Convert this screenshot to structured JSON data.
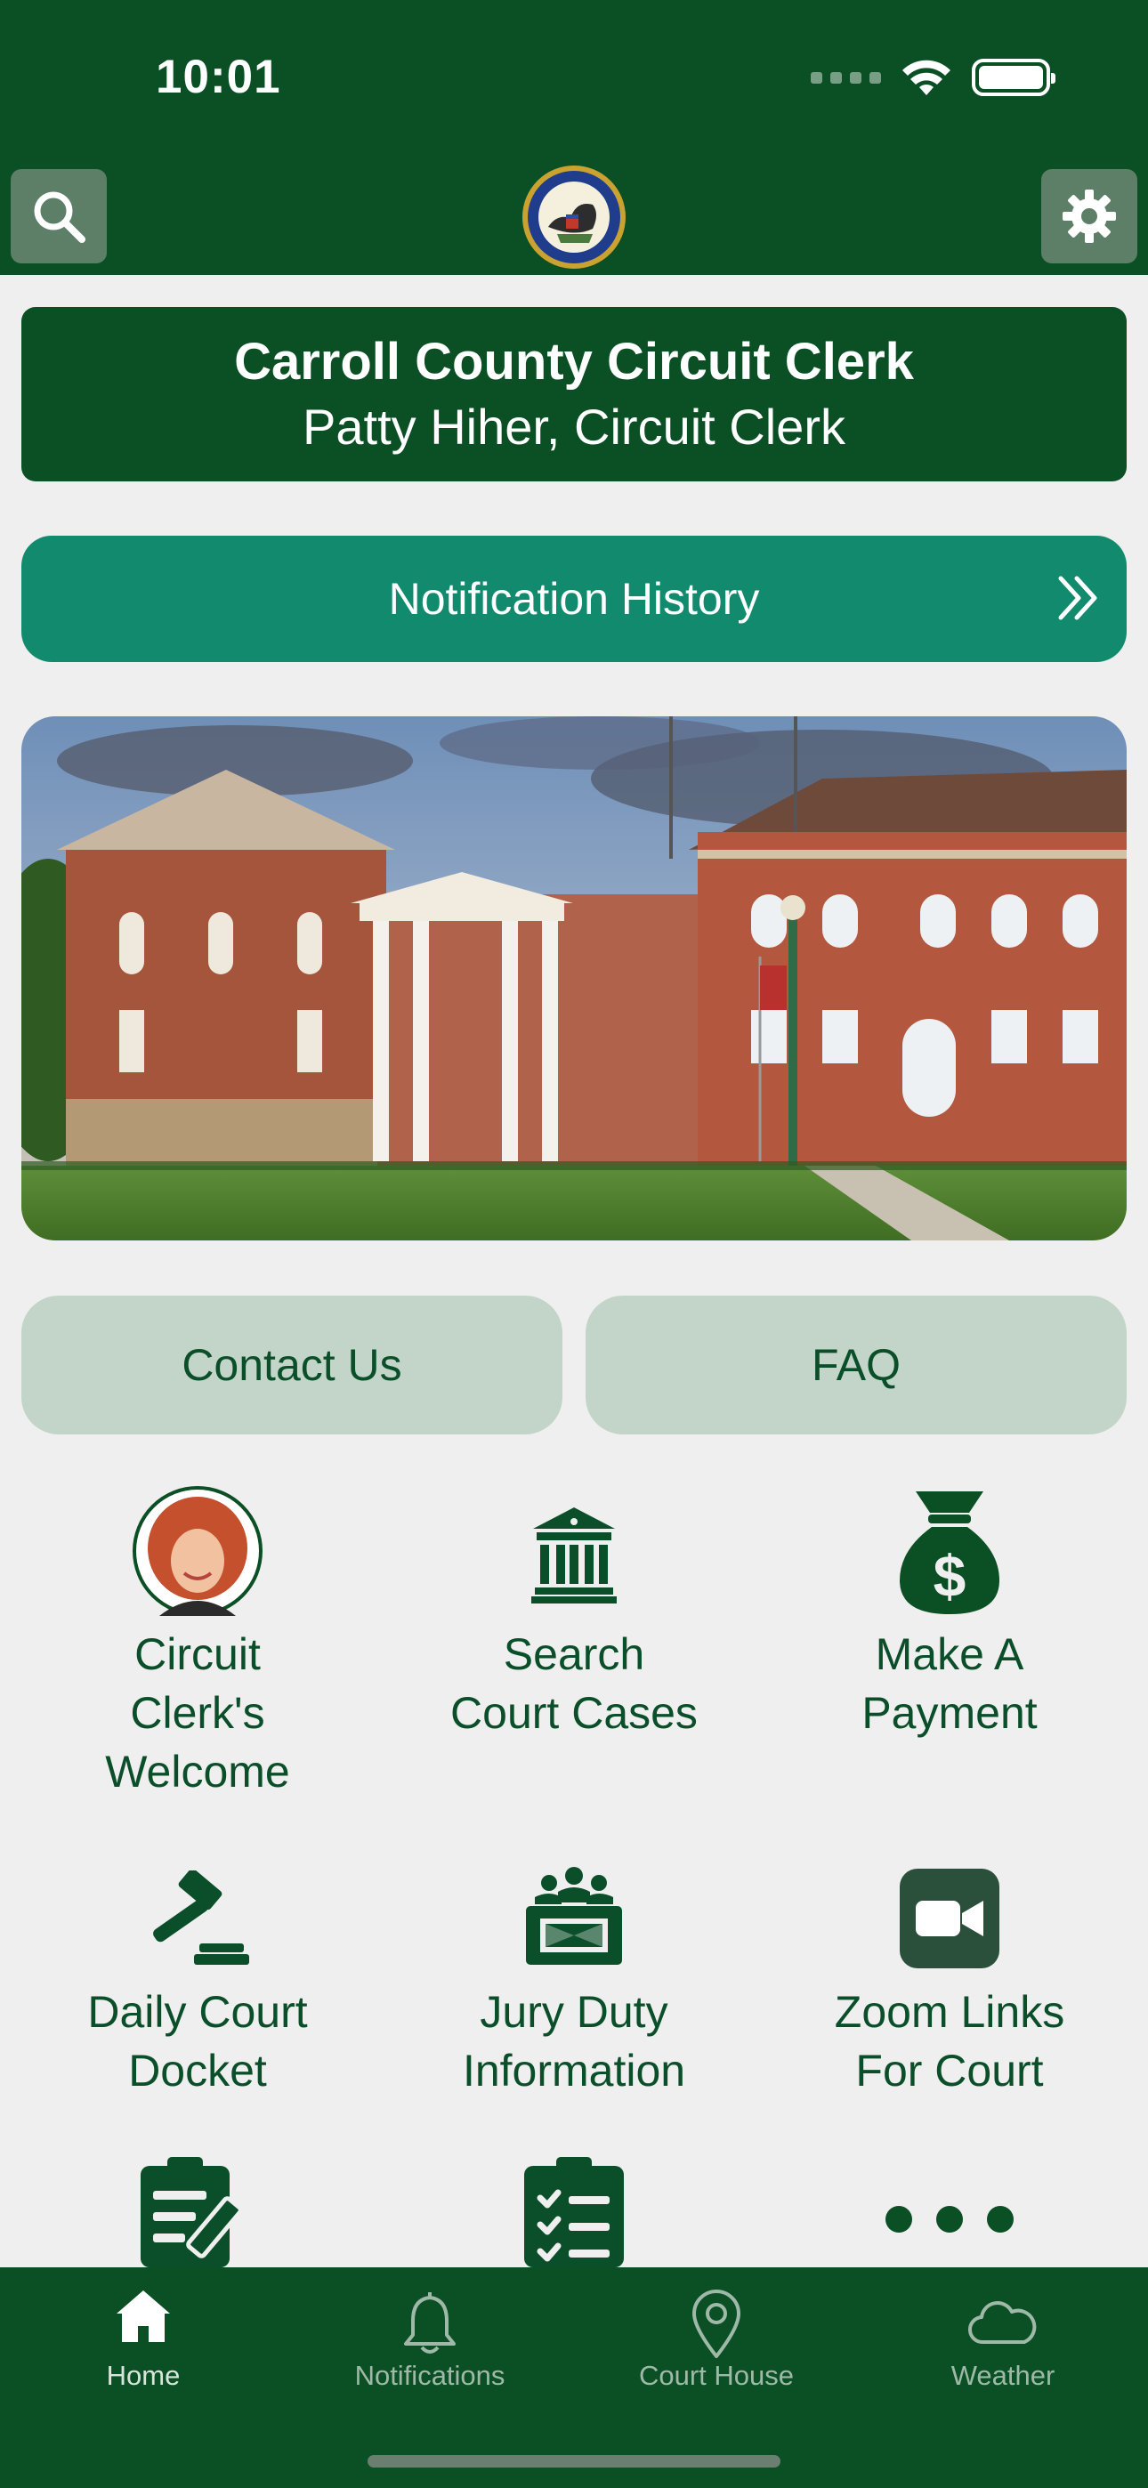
{
  "status_bar": {
    "time": "10:01"
  },
  "nav": {
    "search_icon": "search-icon",
    "settings_icon": "gear-icon",
    "logo": "state-seal"
  },
  "header": {
    "title": "Carroll County Circuit Clerk",
    "subtitle": "Patty Hiher, Circuit Clerk"
  },
  "notification_history": {
    "label": "Notification History",
    "icon": "double-chevron-right-icon"
  },
  "hero": {
    "image": "courthouse-photo"
  },
  "buttons": {
    "contact": "Contact Us",
    "faq": "FAQ"
  },
  "tiles": [
    {
      "label_lines": [
        "Circuit",
        "Clerk's",
        "Welcome"
      ],
      "icon": "clerk-portrait"
    },
    {
      "label_lines": [
        "Search",
        "Court Cases"
      ],
      "icon": "courthouse-icon"
    },
    {
      "label_lines": [
        "Make A",
        "Payment"
      ],
      "icon": "money-bag-icon"
    },
    {
      "label_lines": [
        "Daily Court",
        "Docket"
      ],
      "icon": "gavel-icon"
    },
    {
      "label_lines": [
        "Jury Duty",
        "Information"
      ],
      "icon": "jury-icon"
    },
    {
      "label_lines": [
        "Zoom Links",
        "For Court"
      ],
      "icon": "video-camera-icon"
    },
    {
      "label_lines": [],
      "icon": "clipboard-pen-icon"
    },
    {
      "label_lines": [],
      "icon": "checklist-icon"
    },
    {
      "label_lines": [],
      "icon": "more-icon"
    }
  ],
  "tabbar": [
    {
      "label": "Home",
      "icon": "home-icon",
      "active": true
    },
    {
      "label": "Notifications",
      "icon": "bell-icon",
      "active": false
    },
    {
      "label": "Court House",
      "icon": "location-pin-icon",
      "active": false
    },
    {
      "label": "Weather",
      "icon": "cloud-icon",
      "active": false
    }
  ],
  "colors": {
    "primary": "#0b4f24",
    "accent": "#128a6e",
    "pill": "#c3d5c8",
    "background": "#efefef",
    "text": "#0b4f2a"
  }
}
